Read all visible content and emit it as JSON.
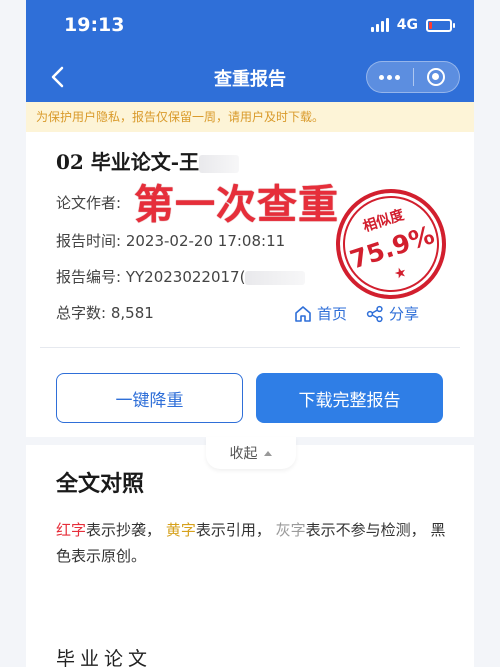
{
  "status_bar": {
    "time": "19:13",
    "network": "4G",
    "battery_level": 0.15,
    "battery_color": "#ff3b30"
  },
  "nav": {
    "title": "查重报告"
  },
  "notice": {
    "text": "为保护用户隐私，报告仅保留一周，请用户及时下载。"
  },
  "report": {
    "title": "02 毕业论文-王",
    "author_label": "论文作者:",
    "time_label": "报告时间:",
    "time_value": "2023-02-20 17:08:11",
    "number_label": "报告编号:",
    "number_value": "YY2023022017(",
    "wordcount_label": "总字数:",
    "wordcount_value": "8,581",
    "home_label": "首页",
    "share_label": "分享"
  },
  "overlay": {
    "stamp_text": "第一次查重",
    "seal_top": "相似度",
    "seal_value": "75.9%",
    "seal_star": "★",
    "color": "#e62e3a"
  },
  "buttons": {
    "reduce": "一键降重",
    "download": "下载完整报告"
  },
  "collapse": {
    "label": "收起"
  },
  "comparison": {
    "title": "全文对照",
    "legend_red": "红字",
    "legend_red_desc": "表示抄袭，",
    "legend_yellow": "黄字",
    "legend_yellow_desc": "表示引用，",
    "legend_gray": "灰字",
    "legend_gray_desc": "表示不参与检测，",
    "legend_black_desc": "黑色表示原创。"
  },
  "document": {
    "title": "毕业论文"
  },
  "colors": {
    "primary": "#2f6fd8",
    "notice_bg": "#fdf4d7",
    "notice_text": "#d99a2b"
  }
}
